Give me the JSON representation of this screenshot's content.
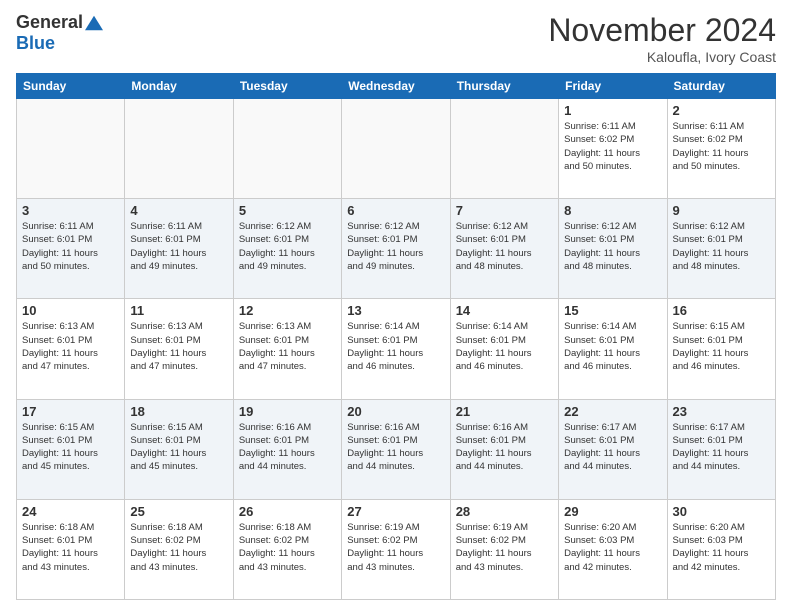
{
  "logo": {
    "general": "General",
    "blue": "Blue"
  },
  "title": "November 2024",
  "location": "Kaloufla, Ivory Coast",
  "weekdays": [
    "Sunday",
    "Monday",
    "Tuesday",
    "Wednesday",
    "Thursday",
    "Friday",
    "Saturday"
  ],
  "weeks": [
    [
      {
        "day": "",
        "info": ""
      },
      {
        "day": "",
        "info": ""
      },
      {
        "day": "",
        "info": ""
      },
      {
        "day": "",
        "info": ""
      },
      {
        "day": "",
        "info": ""
      },
      {
        "day": "1",
        "info": "Sunrise: 6:11 AM\nSunset: 6:02 PM\nDaylight: 11 hours\nand 50 minutes."
      },
      {
        "day": "2",
        "info": "Sunrise: 6:11 AM\nSunset: 6:02 PM\nDaylight: 11 hours\nand 50 minutes."
      }
    ],
    [
      {
        "day": "3",
        "info": "Sunrise: 6:11 AM\nSunset: 6:01 PM\nDaylight: 11 hours\nand 50 minutes."
      },
      {
        "day": "4",
        "info": "Sunrise: 6:11 AM\nSunset: 6:01 PM\nDaylight: 11 hours\nand 49 minutes."
      },
      {
        "day": "5",
        "info": "Sunrise: 6:12 AM\nSunset: 6:01 PM\nDaylight: 11 hours\nand 49 minutes."
      },
      {
        "day": "6",
        "info": "Sunrise: 6:12 AM\nSunset: 6:01 PM\nDaylight: 11 hours\nand 49 minutes."
      },
      {
        "day": "7",
        "info": "Sunrise: 6:12 AM\nSunset: 6:01 PM\nDaylight: 11 hours\nand 48 minutes."
      },
      {
        "day": "8",
        "info": "Sunrise: 6:12 AM\nSunset: 6:01 PM\nDaylight: 11 hours\nand 48 minutes."
      },
      {
        "day": "9",
        "info": "Sunrise: 6:12 AM\nSunset: 6:01 PM\nDaylight: 11 hours\nand 48 minutes."
      }
    ],
    [
      {
        "day": "10",
        "info": "Sunrise: 6:13 AM\nSunset: 6:01 PM\nDaylight: 11 hours\nand 47 minutes."
      },
      {
        "day": "11",
        "info": "Sunrise: 6:13 AM\nSunset: 6:01 PM\nDaylight: 11 hours\nand 47 minutes."
      },
      {
        "day": "12",
        "info": "Sunrise: 6:13 AM\nSunset: 6:01 PM\nDaylight: 11 hours\nand 47 minutes."
      },
      {
        "day": "13",
        "info": "Sunrise: 6:14 AM\nSunset: 6:01 PM\nDaylight: 11 hours\nand 46 minutes."
      },
      {
        "day": "14",
        "info": "Sunrise: 6:14 AM\nSunset: 6:01 PM\nDaylight: 11 hours\nand 46 minutes."
      },
      {
        "day": "15",
        "info": "Sunrise: 6:14 AM\nSunset: 6:01 PM\nDaylight: 11 hours\nand 46 minutes."
      },
      {
        "day": "16",
        "info": "Sunrise: 6:15 AM\nSunset: 6:01 PM\nDaylight: 11 hours\nand 46 minutes."
      }
    ],
    [
      {
        "day": "17",
        "info": "Sunrise: 6:15 AM\nSunset: 6:01 PM\nDaylight: 11 hours\nand 45 minutes."
      },
      {
        "day": "18",
        "info": "Sunrise: 6:15 AM\nSunset: 6:01 PM\nDaylight: 11 hours\nand 45 minutes."
      },
      {
        "day": "19",
        "info": "Sunrise: 6:16 AM\nSunset: 6:01 PM\nDaylight: 11 hours\nand 44 minutes."
      },
      {
        "day": "20",
        "info": "Sunrise: 6:16 AM\nSunset: 6:01 PM\nDaylight: 11 hours\nand 44 minutes."
      },
      {
        "day": "21",
        "info": "Sunrise: 6:16 AM\nSunset: 6:01 PM\nDaylight: 11 hours\nand 44 minutes."
      },
      {
        "day": "22",
        "info": "Sunrise: 6:17 AM\nSunset: 6:01 PM\nDaylight: 11 hours\nand 44 minutes."
      },
      {
        "day": "23",
        "info": "Sunrise: 6:17 AM\nSunset: 6:01 PM\nDaylight: 11 hours\nand 44 minutes."
      }
    ],
    [
      {
        "day": "24",
        "info": "Sunrise: 6:18 AM\nSunset: 6:01 PM\nDaylight: 11 hours\nand 43 minutes."
      },
      {
        "day": "25",
        "info": "Sunrise: 6:18 AM\nSunset: 6:02 PM\nDaylight: 11 hours\nand 43 minutes."
      },
      {
        "day": "26",
        "info": "Sunrise: 6:18 AM\nSunset: 6:02 PM\nDaylight: 11 hours\nand 43 minutes."
      },
      {
        "day": "27",
        "info": "Sunrise: 6:19 AM\nSunset: 6:02 PM\nDaylight: 11 hours\nand 43 minutes."
      },
      {
        "day": "28",
        "info": "Sunrise: 6:19 AM\nSunset: 6:02 PM\nDaylight: 11 hours\nand 43 minutes."
      },
      {
        "day": "29",
        "info": "Sunrise: 6:20 AM\nSunset: 6:03 PM\nDaylight: 11 hours\nand 42 minutes."
      },
      {
        "day": "30",
        "info": "Sunrise: 6:20 AM\nSunset: 6:03 PM\nDaylight: 11 hours\nand 42 minutes."
      }
    ]
  ]
}
